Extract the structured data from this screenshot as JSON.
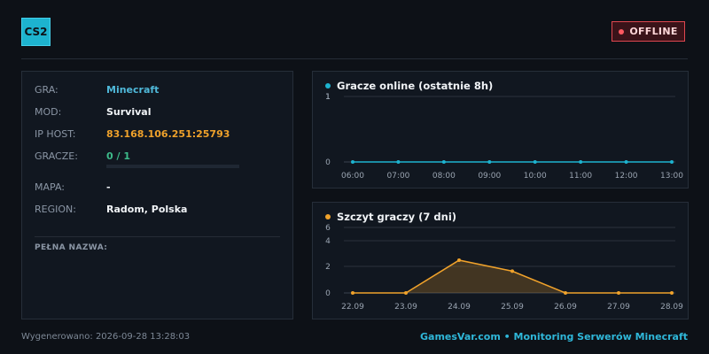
{
  "header": {
    "logo": "CS2",
    "status": "OFFLINE"
  },
  "colors": {
    "accent": "#1db3cf",
    "offline": "#e0474f",
    "players_line": "#1db3cf",
    "peak_line": "#f0a22b"
  },
  "info": {
    "game_label": "GRA:",
    "game_value": "Minecraft",
    "mod_label": "MOD:",
    "mod_value": "Survival",
    "ip_label": "IP HOST:",
    "ip_value": "83.168.106.251:25793",
    "players_label": "GRACZE:",
    "players_value": "0 / 1",
    "players_fraction": 0,
    "map_label": "MAPA:",
    "map_value": "-",
    "region_label": "REGION:",
    "region_value": "Radom, Polska",
    "fullname_label": "PEŁNA NAZWA:"
  },
  "chart_data": [
    {
      "type": "line",
      "title": "Gracze online (ostatnie 8h)",
      "x": [
        "06:00",
        "07:00",
        "08:00",
        "09:00",
        "10:00",
        "11:00",
        "12:00",
        "13:00"
      ],
      "values": [
        0,
        0,
        0,
        0,
        0,
        0,
        0,
        0
      ],
      "ylim": [
        0,
        1
      ],
      "yticks": [
        "0",
        "1",
        "1",
        "1"
      ],
      "grid": true
    },
    {
      "type": "area",
      "title": "Szczyt graczy (7 dni)",
      "x": [
        "22.09",
        "23.09",
        "24.09",
        "25.09",
        "26.09",
        "27.09",
        "28.09"
      ],
      "values": [
        0,
        0,
        3,
        2,
        0,
        0,
        0
      ],
      "ylim": [
        0,
        6
      ],
      "yticks": [
        "0",
        "2",
        "4",
        "6"
      ],
      "grid": true
    }
  ],
  "footer": {
    "generated": "Wygenerowano: 2026-09-28 13:28:03",
    "brand": "GamesVar.com • Monitoring Serwerów Minecraft"
  }
}
